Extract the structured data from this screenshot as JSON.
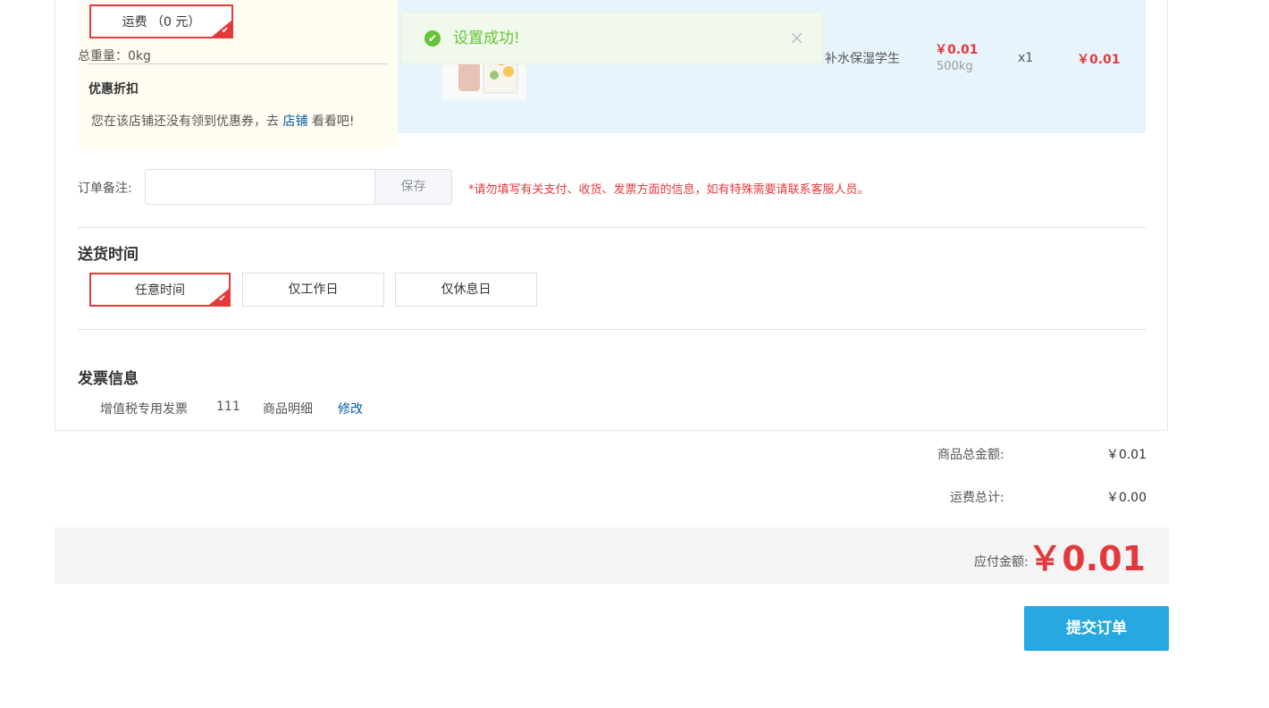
{
  "shipping": {
    "fee_option": "运费 （0 元）",
    "weight": "总重量：0kg",
    "discount_title": "优惠折扣",
    "discount_text_before": "您在该店铺还没有领到优惠券，去",
    "discount_link": "店铺",
    "discount_text_after": "看看吧!"
  },
  "toast": {
    "icon": "check-circle-icon",
    "message": "设置成功!",
    "close": "×"
  },
  "product": {
    "name_fragment": "补水保湿学生",
    "price": "￥0.01",
    "weight": "500kg",
    "qty": "x1",
    "subtotal": "￥0.01"
  },
  "remark": {
    "label": "订单备注:",
    "value": "",
    "placeholder": "",
    "save": "保存",
    "warning": "*请勿填写有关支付、收货、发票方面的信息，如有特殊需要请联系客服人员。"
  },
  "delivery": {
    "title": "送货时间",
    "options": [
      "任意时间",
      "仅工作日",
      "仅休息日"
    ],
    "selected": "任意时间"
  },
  "invoice": {
    "title": "发票信息",
    "type": "增值税专用发票",
    "header": "111",
    "content": "商品明细",
    "edit": "修改"
  },
  "summary": {
    "goods_total_label": "商品总金额:",
    "goods_total": "￥0.01",
    "freight_label": "运费总计:",
    "freight": "￥0.00",
    "payable_label": "应付金额:",
    "payable": "￥0.01"
  },
  "submit": "提交订单",
  "colors": {
    "accent_red": "#e4393c",
    "submit_blue": "#28a8e0",
    "success_green": "#67c23a"
  }
}
